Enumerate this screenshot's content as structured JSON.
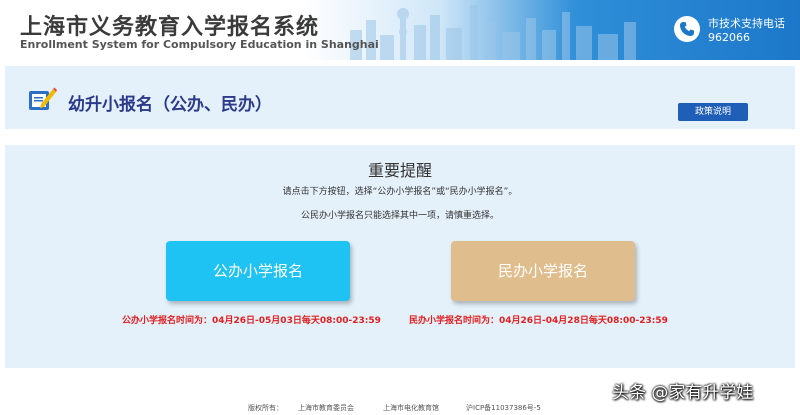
{
  "header": {
    "title_cn": "上海市义务教育入学报名系统",
    "title_en": "Enrollment System for Compulsory Education in Shanghai",
    "hotline_label": "市技术支持电话",
    "hotline_number": "962066",
    "phone_icon": "phone-icon"
  },
  "section": {
    "title": "幼升小报名（公办、民办）",
    "policy_button": "政策说明",
    "icon": "pencil-icon"
  },
  "notice": {
    "title": "重要提醒",
    "line1": "请点击下方按钮，选择“公办小学报名”或“民办小学报名”。",
    "line2": "公民办小学报名只能选择其中一项，请慎重选择。"
  },
  "buttons": {
    "public": "公办小学报名",
    "private": "民办小学报名"
  },
  "times": {
    "public": "公办小学报名时间为：04月26日-05月03日每天08:00-23:59",
    "private": "民办小学报名时间为：04月26日-04月28日每天08:00-23:59"
  },
  "footer": {
    "copyright": "版权所有：",
    "org1": "上海市教育委员会",
    "org2": "上海市电化教育馆",
    "icp": "沪ICP备11037386号-5"
  },
  "watermark": "头条 @家有升学娃",
  "colors": {
    "public_button": "#1fc3f3",
    "private_button": "#dfbd8c",
    "time_text": "#e02020",
    "section_title": "#2b3a8b",
    "policy_button": "#1f5fb8"
  }
}
